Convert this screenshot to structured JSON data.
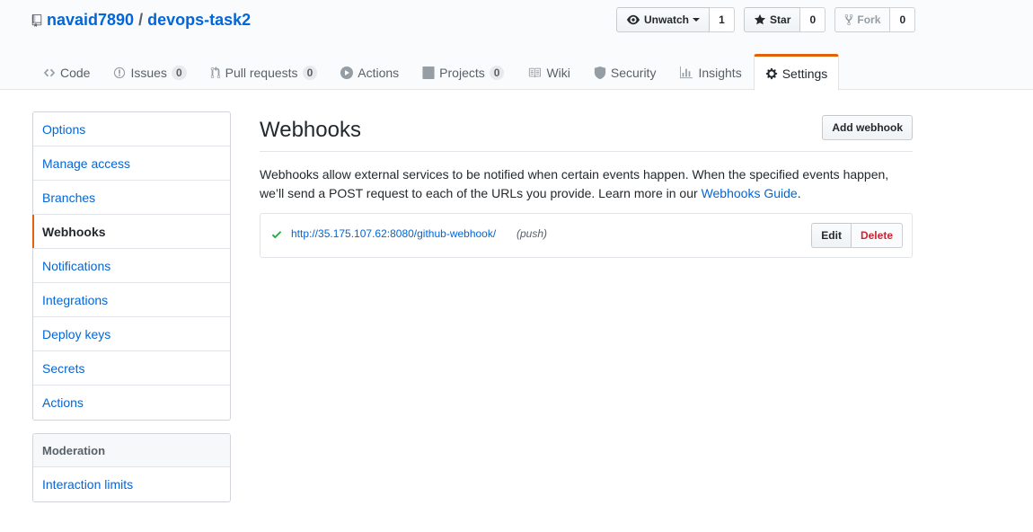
{
  "repo": {
    "owner": "navaid7890",
    "separator": "/",
    "name": "devops-task2"
  },
  "actions": {
    "watch": {
      "label": "Unwatch",
      "count": "1"
    },
    "star": {
      "label": "Star",
      "count": "0"
    },
    "fork": {
      "label": "Fork",
      "count": "0"
    }
  },
  "nav": {
    "code": "Code",
    "issues": {
      "label": "Issues",
      "count": "0"
    },
    "pulls": {
      "label": "Pull requests",
      "count": "0"
    },
    "actions": "Actions",
    "projects": {
      "label": "Projects",
      "count": "0"
    },
    "wiki": "Wiki",
    "security": "Security",
    "insights": "Insights",
    "settings": "Settings"
  },
  "sidebar": {
    "items": [
      "Options",
      "Manage access",
      "Branches",
      "Webhooks",
      "Notifications",
      "Integrations",
      "Deploy keys",
      "Secrets",
      "Actions"
    ],
    "moderation": {
      "heading": "Moderation",
      "items": [
        "Interaction limits"
      ]
    }
  },
  "main": {
    "title": "Webhooks",
    "add_button": "Add webhook",
    "description_1": "Webhooks allow external services to be notified when certain events happen. When the specified events happen, we’ll send a POST request to each of the URLs you provide. Learn more in our ",
    "guide_link": "Webhooks Guide",
    "description_end": ".",
    "hook": {
      "url": "http://35.175.107.62:8080/github-webhook/",
      "events": "(push)",
      "edit": "Edit",
      "delete": "Delete"
    }
  },
  "colors": {
    "accent": "#e36209",
    "link": "#0366d6",
    "success": "#28a745",
    "danger": "#cb2431"
  }
}
